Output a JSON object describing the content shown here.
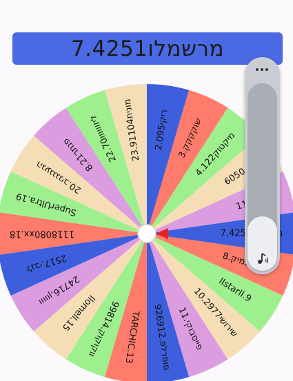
{
  "result": {
    "text": "7.מרשמלו4251",
    "color": "#4a69e2"
  },
  "wheel": {
    "segments": [
      {
        "label": "2.ריקי095",
        "color": "#3d5fdd"
      },
      {
        "label": "3.שוקקקק",
        "color": "#ff7b6b"
      },
      {
        "label": "4.122מיקטוק",
        "color": "#9ef08f"
      },
      {
        "label": "6050",
        "color": "#f5deb5"
      },
      {
        "label": "1180",
        "color": "#dc9de0"
      },
      {
        "label": "7.מרשמלו4251",
        "color": "#3d5fdd"
      },
      {
        "label": "8.אפרת5מיק",
        "color": "#ff7b6b"
      },
      {
        "label": "IIstarII.9",
        "color": "#9ef08f"
      },
      {
        "label": "10.שירושי2977",
        "color": "#f5deb5"
      },
      {
        "label": "11.פייסבוקי",
        "color": "#dc9de0"
      },
      {
        "label": "9269סופרלפ.12",
        "color": "#3d5fdd"
      },
      {
        "label": "TARCHIC.13",
        "color": "#ff7b6b"
      },
      {
        "label": "998ווקוקוק.14",
        "color": "#9ef08f"
      },
      {
        "label": "llomell.15",
        "color": "#f5deb5"
      },
      {
        "label": "247ווווון.16",
        "color": "#dc9de0"
      },
      {
        "label": "25לגבי.17",
        "color": "#3d5fdd"
      },
      {
        "label": "1118080xx.18",
        "color": "#ff7b6b"
      },
      {
        "label": "SuperUltra.19",
        "color": "#9ef08f"
      },
      {
        "label": "הגעגגגגיב.20",
        "color": "#f5deb5"
      },
      {
        "label": "פנתר8.21",
        "color": "#dc9de0"
      },
      {
        "label": "22.ליזוווווו70",
        "color": "#9ef08f"
      },
      {
        "label": "23.מונית91104",
        "color": "#f5deb5"
      }
    ]
  },
  "pointer": {
    "color": "#e8211a"
  },
  "volume": {
    "icon": "speaker-icon",
    "menu_icon": "more-dots-icon",
    "level": 0.25
  }
}
